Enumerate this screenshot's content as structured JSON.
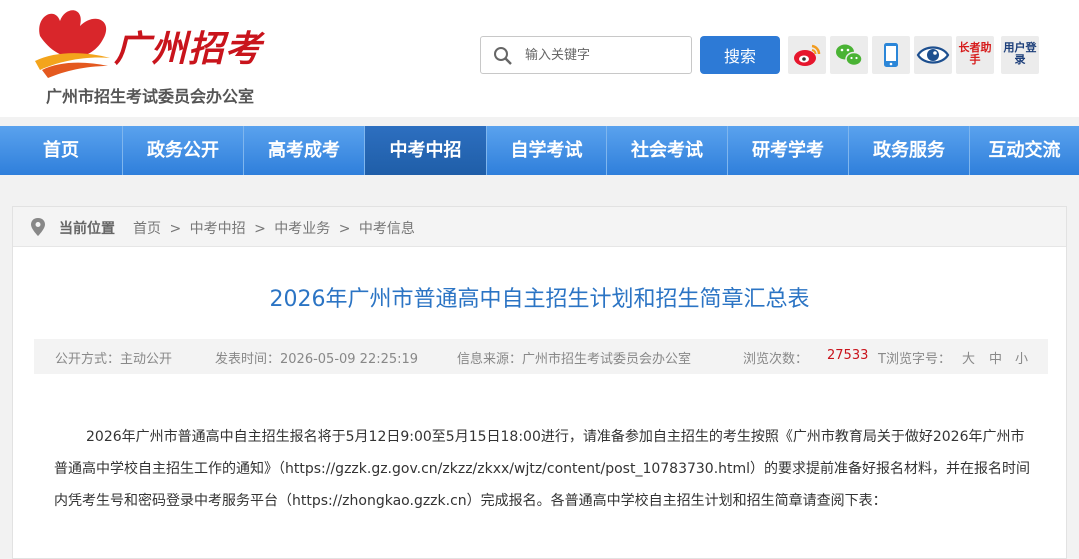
{
  "header": {
    "logo_text": "广州招考",
    "org_name": "广州市招生考试委员会办公室",
    "search": {
      "placeholder": "输入关键字",
      "button_label": "搜索"
    },
    "tools": [
      {
        "name": "weibo-icon"
      },
      {
        "name": "wechat-icon"
      },
      {
        "name": "mobile-icon"
      },
      {
        "name": "eye-icon"
      },
      {
        "name": "elder-assistant-icon",
        "label": "长者助手"
      },
      {
        "name": "user-login-icon",
        "label": "用户登录"
      }
    ]
  },
  "nav": {
    "items": [
      "首页",
      "政务公开",
      "高考成考",
      "中考中招",
      "自学考试",
      "社会考试",
      "研考学考",
      "政务服务",
      "互动交流"
    ],
    "active_index": 3
  },
  "breadcrumb": {
    "label": "当前位置",
    "trail": [
      "首页",
      ">",
      "中考中招",
      ">",
      "中考业务",
      ">",
      "中考信息"
    ]
  },
  "article": {
    "title": "2026年广州市普通高中自主招生计划和招生简章汇总表",
    "meta": {
      "disclosure": "公开方式：主动公开",
      "published": "发表时间：2026-05-09 22:25:19",
      "source": "信息来源：广州市招生考试委员会办公室",
      "views_label": "浏览次数：",
      "views": "27533",
      "font_label": "T浏览字号：",
      "font_large": "大",
      "font_medium": "中",
      "font_small": "小"
    },
    "paragraph": "2026年广州市普通高中自主招生报名将于5月12日9:00至5月15日18:00进行，请准备参加自主招生的考生按照《广州市教育局关于做好2026年广州市普通高中学校自主招生工作的通知》（https://gzzk.gz.gov.cn/zkzz/zkxx/wjtz/content/post_10783730.html）的要求提前准备好报名材料，并在报名时间内凭考生号和密码登录中考服务平台（https://zhongkao.gzzk.cn）完成报名。各普通高中学校自主招生计划和招生简章请查阅下表："
  },
  "colors": {
    "brand_red": "#c9141c",
    "nav_blue": "#2f7fdb",
    "title_blue": "#2b74c4",
    "search_blue": "#2d7ad6"
  }
}
